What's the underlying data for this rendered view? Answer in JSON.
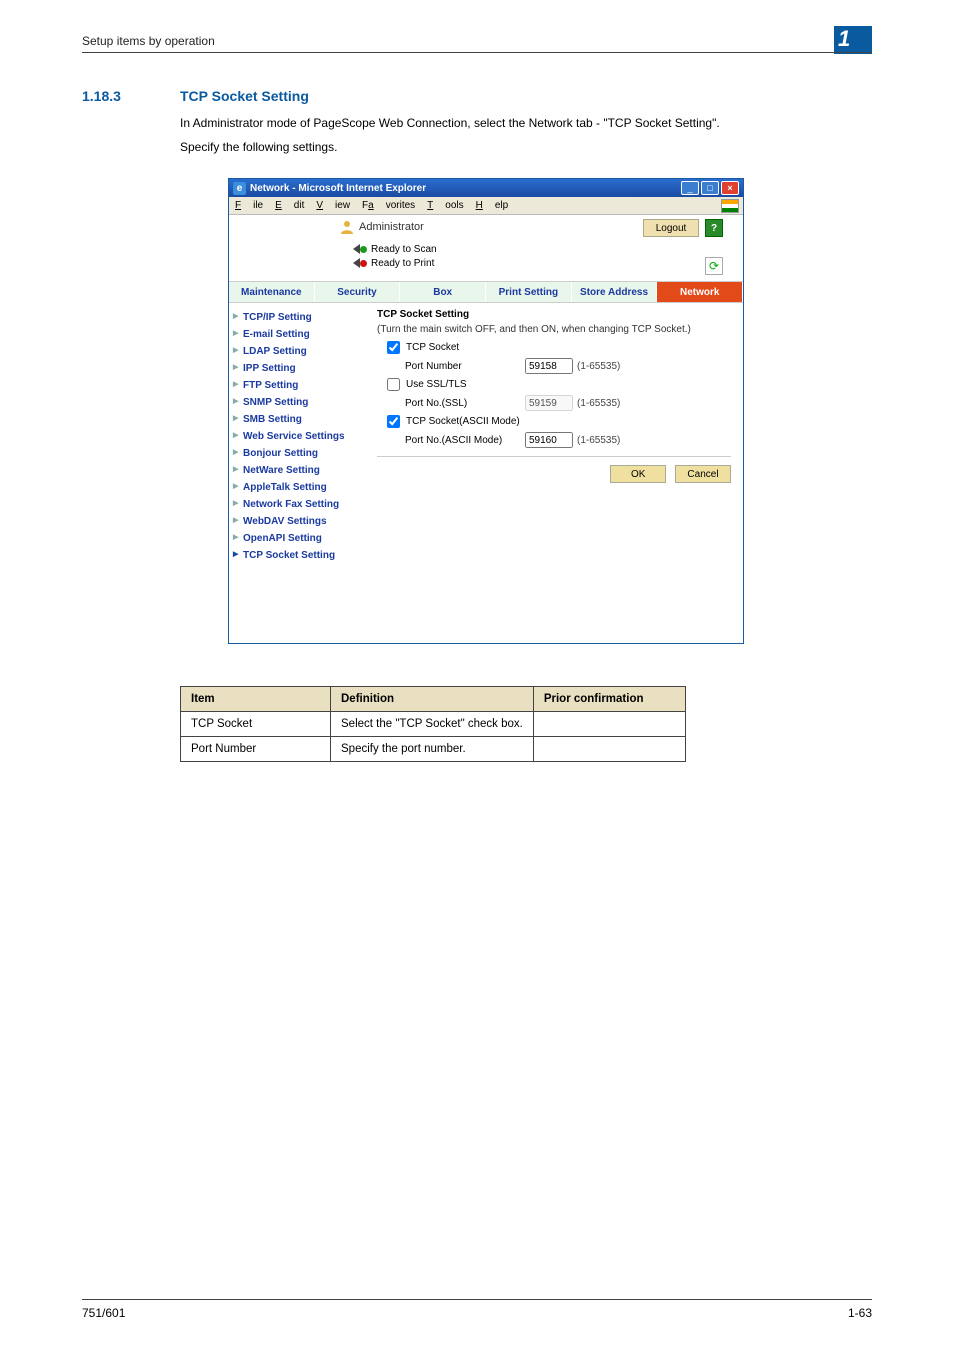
{
  "header": {
    "label": "Setup items by operation",
    "badge": "1"
  },
  "section": {
    "number": "1.18.3",
    "title": "TCP Socket Setting"
  },
  "paragraphs": {
    "p1": "In Administrator mode of PageScope Web Connection, select the Network tab - \"TCP Socket Setting\".",
    "p2": "Specify the following settings."
  },
  "window": {
    "title": "Network - Microsoft Internet Explorer",
    "menus": {
      "file": "File",
      "edit": "Edit",
      "view": "View",
      "favorites": "Favorites",
      "tools": "Tools",
      "help": "Help"
    },
    "admin_label": "Administrator",
    "logout": "Logout",
    "help": "?",
    "status": {
      "scan": "Ready to Scan",
      "print": "Ready to Print"
    },
    "refresh_glyph": "⟳",
    "tabs": {
      "maintenance": "Maintenance",
      "security": "Security",
      "box": "Box",
      "print": "Print Setting",
      "store": "Store Address",
      "network": "Network"
    },
    "sidenav": {
      "tcpip": "TCP/IP Setting",
      "email": "E-mail Setting",
      "ldap": "LDAP Setting",
      "ipp": "IPP Setting",
      "ftp": "FTP Setting",
      "snmp": "SNMP Setting",
      "smb": "SMB Setting",
      "websvc": "Web Service Settings",
      "bonjour": "Bonjour Setting",
      "netware": "NetWare Setting",
      "appletalk": "AppleTalk Setting",
      "netfax": "Network Fax Setting",
      "webdav": "WebDAV Settings",
      "openapi": "OpenAPI Setting",
      "tcpsocket": "TCP Socket Setting"
    },
    "panel": {
      "title": "TCP Socket Setting",
      "note": "(Turn the main switch OFF, and then ON, when changing TCP Socket.)",
      "tcp_socket": "TCP Socket",
      "port_number": "Port Number",
      "port_number_val": "59158",
      "use_ssl": "Use SSL/TLS",
      "port_ssl": "Port No.(SSL)",
      "port_ssl_val": "59159",
      "tcp_ascii": "TCP Socket(ASCII Mode)",
      "port_ascii": "Port No.(ASCII Mode)",
      "port_ascii_val": "59160",
      "range": "(1-65535)",
      "ok": "OK",
      "cancel": "Cancel"
    }
  },
  "table": {
    "h1": "Item",
    "h2": "Definition",
    "h3": "Prior confirmation",
    "r1c1": "TCP Socket",
    "r1c2": "Select the \"TCP Socket\" check box.",
    "r1c3": "",
    "r2c1": "Port Number",
    "r2c2": "Specify the port number.",
    "r2c3": ""
  },
  "footer": {
    "left": "751/601",
    "right": "1-63"
  }
}
